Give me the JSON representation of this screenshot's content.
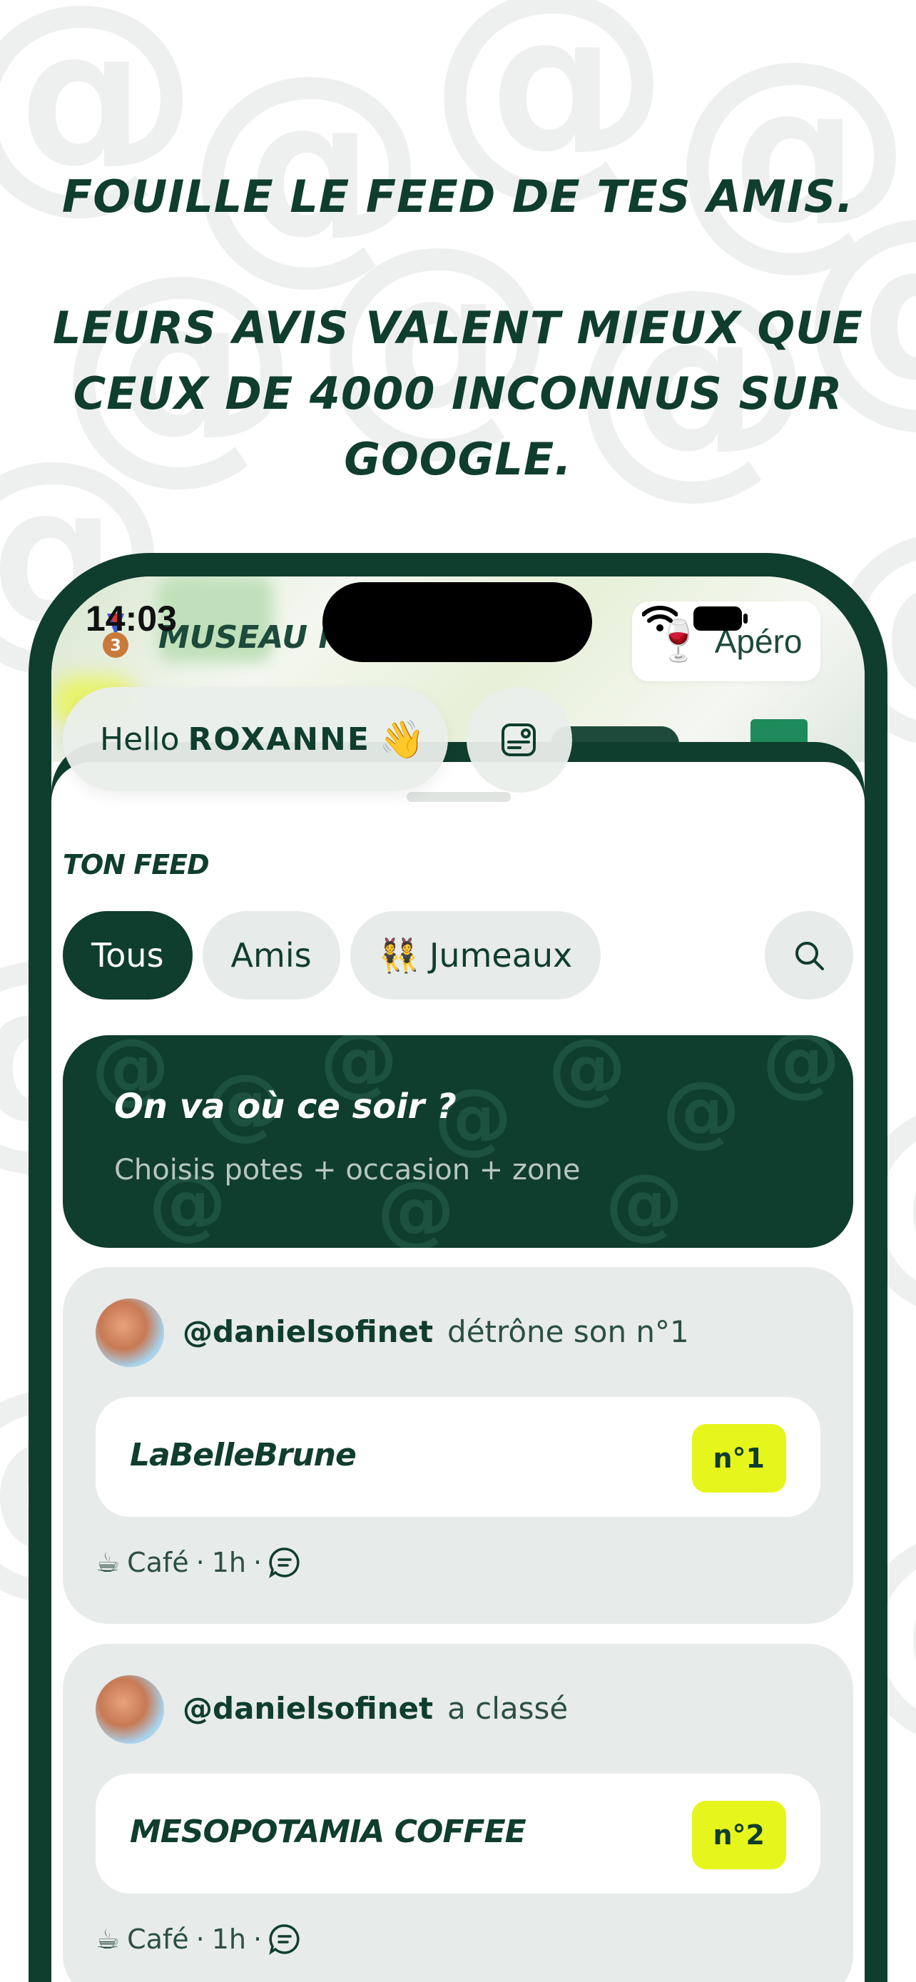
{
  "headline": {
    "line1": "FOUILLE LE FEED DE TES AMIS.",
    "line2": "LEURS AVIS VALENT MIEUX QUE",
    "line3": "CEUX DE 4000 INCONNUS SUR",
    "line4": "GOOGLE."
  },
  "status_bar": {
    "time": "14:03"
  },
  "venue_header": {
    "title": "MUSEAU M",
    "medal_icon": "bronze-medal-icon"
  },
  "apero_pill": {
    "icon": "wine-glass-icon",
    "label": "Apéro"
  },
  "greeting": {
    "hello": "Hello",
    "name": "ROXANNE",
    "icon": "waving-hand-icon"
  },
  "feed": {
    "section_title": "TON FEED",
    "tabs": [
      {
        "label": "Tous",
        "active": true
      },
      {
        "label": "Amis",
        "active": false
      },
      {
        "label": "Jumeaux",
        "active": false,
        "icon": "twins-icon"
      }
    ],
    "cta": {
      "title": "On va où ce soir ?",
      "subtitle": "Choisis potes + occasion + zone"
    },
    "items": [
      {
        "user": "@danielsofinet",
        "action": "détrône son n°1",
        "venue": "LaBelleBrune",
        "rank": "n°1",
        "category_icon": "coffee-icon",
        "category": "Café",
        "time": "1h"
      },
      {
        "user": "@danielsofinet",
        "action": "a classé",
        "venue": "MESOPOTAMIA COFFEE",
        "rank": "n°2",
        "category_icon": "coffee-icon",
        "category": "Café",
        "time": "1h"
      }
    ]
  },
  "colors": {
    "brand_dark_green": "#0f3d2e",
    "pill_grey": "#e7ebe9",
    "rank_yellow": "#e6f51b",
    "background": "#ffffff"
  }
}
